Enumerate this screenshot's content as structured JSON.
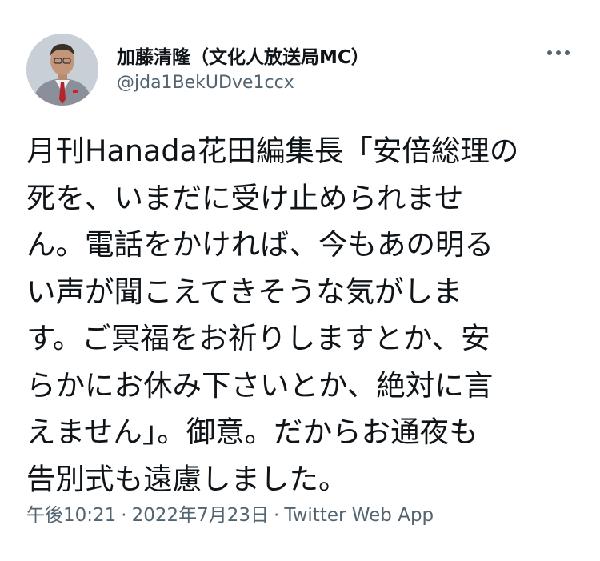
{
  "author": {
    "name": "加藤清隆（文化人放送局MC）",
    "handle": "@jda1BekUDve1ccx"
  },
  "tweet": {
    "lines": [
      "月刊Hanada花田編集長「安倍総理の",
      "死を、いまだに受け止められませ",
      "ん。電話をかければ、今もあの明る",
      "い声が聞こえてきそうな気がしま",
      "す。ご冥福をお祈りしますとか、安",
      "らかにお休み下さいとか、絶対に言",
      "えません」。御意。だからお通夜も",
      "告別式も遠慮しました。"
    ]
  },
  "meta": {
    "time": "午後10:21",
    "separator1": "·",
    "date": "2022年7月23日",
    "separator2": "·",
    "source": "Twitter Web App"
  },
  "icons": {
    "avatar": "user-avatar-photo",
    "more": "more-horizontal-icon"
  },
  "colors": {
    "text": "#0f1419",
    "secondary": "#536471",
    "divider": "#eff3f4"
  }
}
